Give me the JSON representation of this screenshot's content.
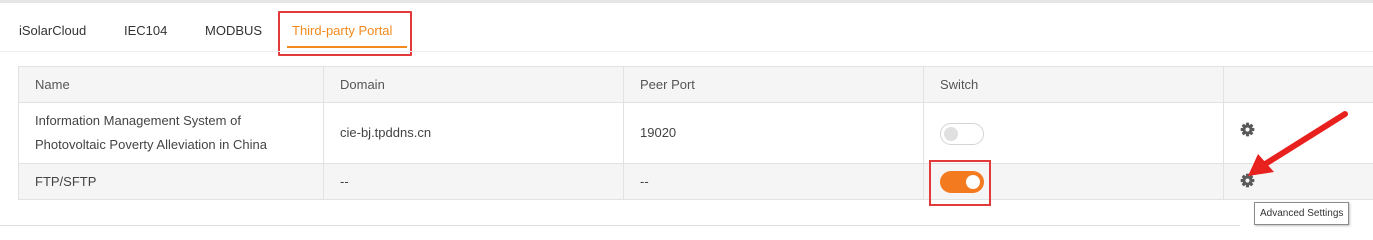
{
  "tabs": [
    {
      "label": "iSolarCloud",
      "active": false
    },
    {
      "label": "IEC104",
      "active": false
    },
    {
      "label": "MODBUS",
      "active": false
    },
    {
      "label": "Third-party Portal",
      "active": true
    }
  ],
  "table": {
    "headers": [
      "Name",
      "Domain",
      "Peer Port",
      "Switch",
      ""
    ],
    "rows": [
      {
        "name_line1": "Information Management System of",
        "name_line2": "Photovoltaic Poverty Alleviation in China",
        "domain": "cie-bj.tpddns.cn",
        "peer_port": "19020",
        "switch": "off",
        "action_icon": "gear-icon"
      },
      {
        "name": "FTP/SFTP",
        "domain": "--",
        "peer_port": "--",
        "switch": "on",
        "action_icon": "gear-icon"
      }
    ]
  },
  "tooltip": "Advanced Settings",
  "colors": {
    "accent": "#f28a1e",
    "switch_on": "#f47a20",
    "highlight": "#e23a3a",
    "arrow": "#e8201e"
  }
}
